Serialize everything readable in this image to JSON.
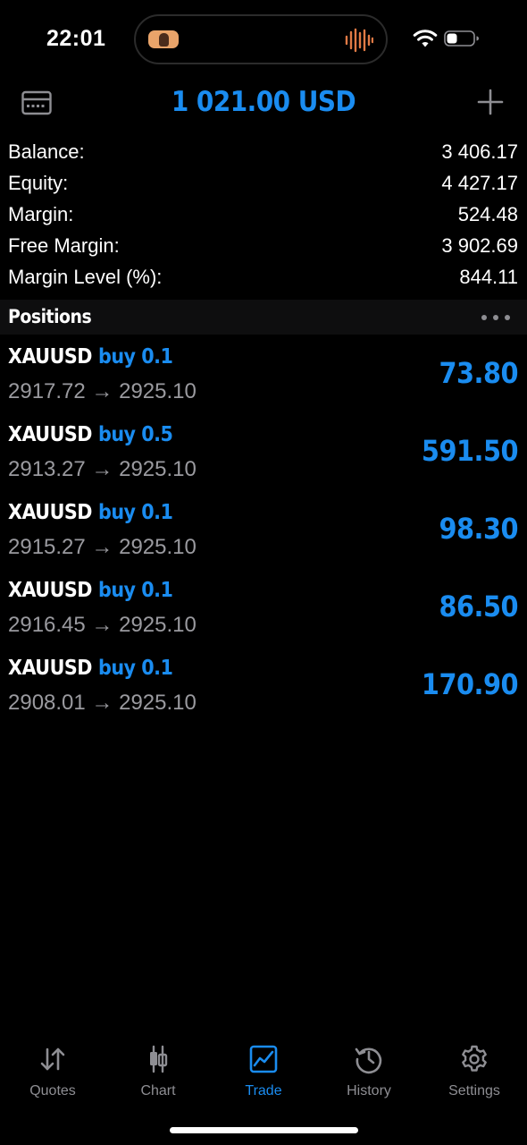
{
  "status_bar": {
    "time": "22:01"
  },
  "header": {
    "title": "1 021.00 USD"
  },
  "summary": [
    {
      "label": "Balance:",
      "value": "3 406.17"
    },
    {
      "label": "Equity:",
      "value": "4 427.17"
    },
    {
      "label": "Margin:",
      "value": "524.48"
    },
    {
      "label": "Free Margin:",
      "value": "3 902.69"
    },
    {
      "label": "Margin Level (%):",
      "value": "844.11"
    }
  ],
  "positions_section": {
    "title": "Positions"
  },
  "positions": [
    {
      "symbol": "XAUUSD",
      "side": "buy 0.1",
      "prices": "2917.72 → 2925.10",
      "profit": "73.80"
    },
    {
      "symbol": "XAUUSD",
      "side": "buy 0.5",
      "prices": "2913.27 → 2925.10",
      "profit": "591.50"
    },
    {
      "symbol": "XAUUSD",
      "side": "buy 0.1",
      "prices": "2915.27 → 2925.10",
      "profit": "98.30"
    },
    {
      "symbol": "XAUUSD",
      "side": "buy 0.1",
      "prices": "2916.45 → 2925.10",
      "profit": "86.50"
    },
    {
      "symbol": "XAUUSD",
      "side": "buy 0.1",
      "prices": "2908.01 → 2925.10",
      "profit": "170.90"
    }
  ],
  "tabs": [
    {
      "label": "Quotes",
      "icon": "quotes-icon",
      "active": false
    },
    {
      "label": "Chart",
      "icon": "chart-icon",
      "active": false
    },
    {
      "label": "Trade",
      "icon": "trade-icon",
      "active": true
    },
    {
      "label": "History",
      "icon": "history-icon",
      "active": false
    },
    {
      "label": "Settings",
      "icon": "settings-icon",
      "active": false
    }
  ],
  "colors": {
    "accent": "#1a8cf0",
    "background": "#000000",
    "section_header": "#0e0e0f",
    "secondary_text": "#9a9a9f",
    "tab_inactive": "#8e8e93",
    "island_wave": "#e07a45"
  }
}
